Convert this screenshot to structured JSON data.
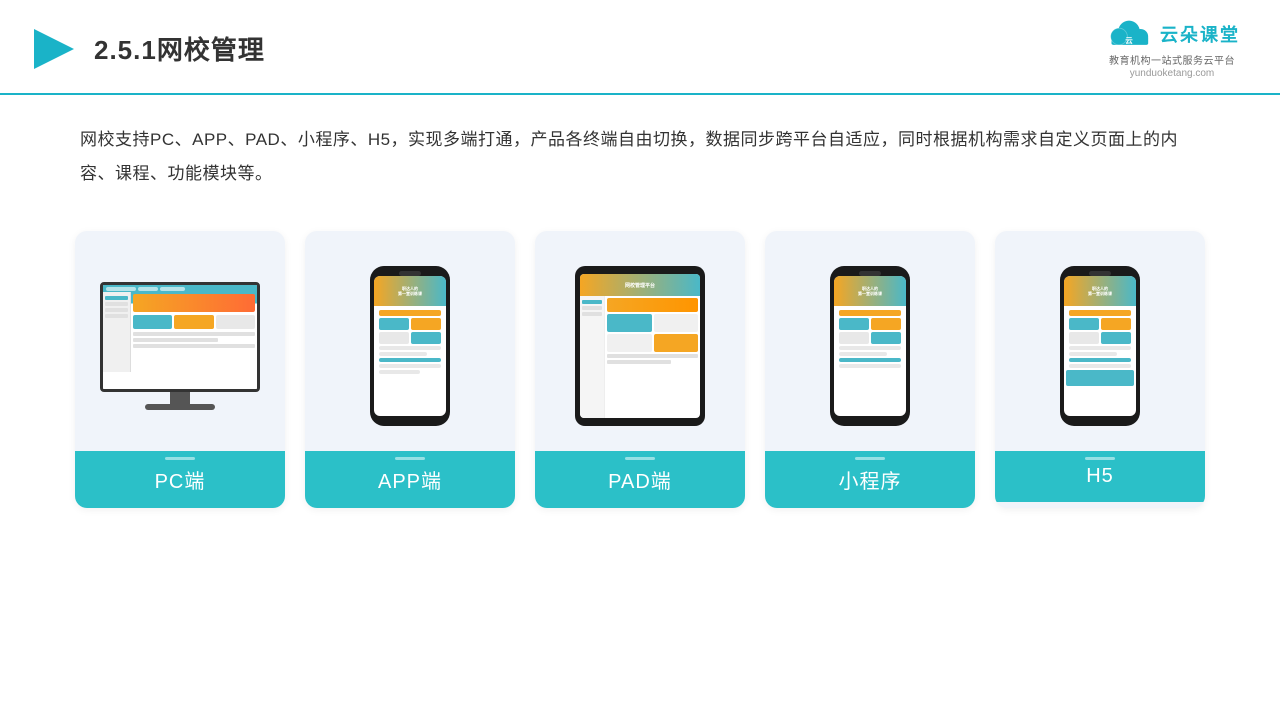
{
  "header": {
    "title": "2.5.1网校管理",
    "logo_text": "云朵课堂",
    "logo_sub": "教育机构一站式服务云平台",
    "logo_domain": "yunduoketang.com"
  },
  "description": {
    "text": "网校支持PC、APP、PAD、小程序、H5，实现多端打通，产品各终端自由切换，数据同步跨平台自适应，同时根据机构需求自定义页面上的内容、课程、功能模块等。"
  },
  "cards": [
    {
      "id": "pc",
      "label": "PC端"
    },
    {
      "id": "app",
      "label": "APP端"
    },
    {
      "id": "pad",
      "label": "PAD端"
    },
    {
      "id": "miniprogram",
      "label": "小程序"
    },
    {
      "id": "h5",
      "label": "H5"
    }
  ]
}
